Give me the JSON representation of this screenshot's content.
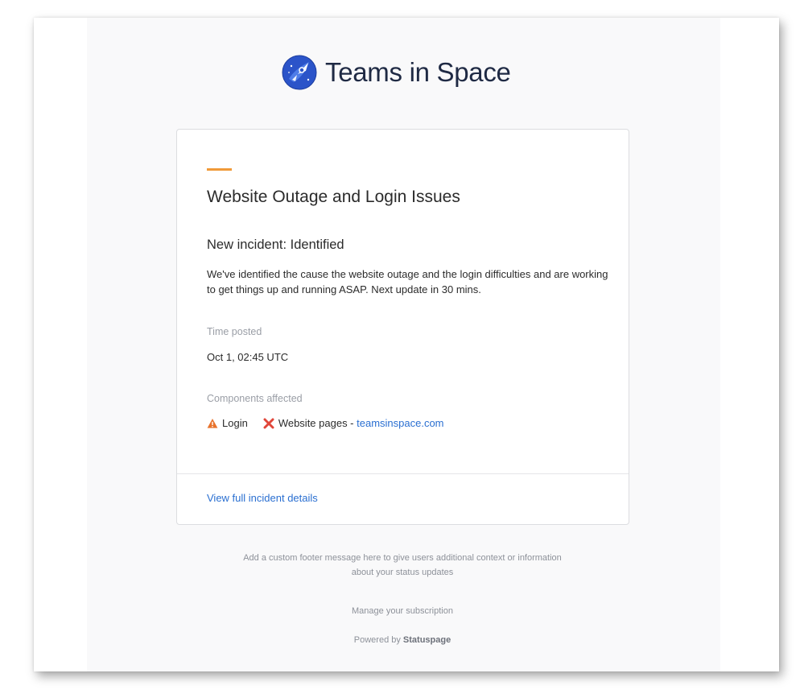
{
  "brand": {
    "name": "Teams in Space",
    "logo_icon": "rocket-planet-icon",
    "color": "#2b54c9"
  },
  "incident": {
    "accent_color": "#f09a39",
    "title": "Website Outage and Login Issues",
    "update_heading": "New incident: Identified",
    "update_body": "We've identified the cause the website outage and the login difficulties and are working to get things up and running ASAP. Next update in 30 mins.",
    "time_label": "Time posted",
    "time_value": "Oct 1, 02:45 UTC",
    "components_label": "Components affected",
    "components": [
      {
        "icon": "warning-triangle-icon",
        "status_color": "#e8732c",
        "name": "Login"
      },
      {
        "icon": "x-mark-icon",
        "status_color": "#e0463a",
        "name": "Website pages - ",
        "link": "teamsinspace.com"
      }
    ],
    "details_link": "View full incident details"
  },
  "footer": {
    "message_line1": "Add a custom footer message here to give users additional context or information",
    "message_line2": "about your status updates",
    "manage": "Manage your subscription",
    "powered_prefix": "Powered by ",
    "powered_brand": "Statuspage"
  }
}
